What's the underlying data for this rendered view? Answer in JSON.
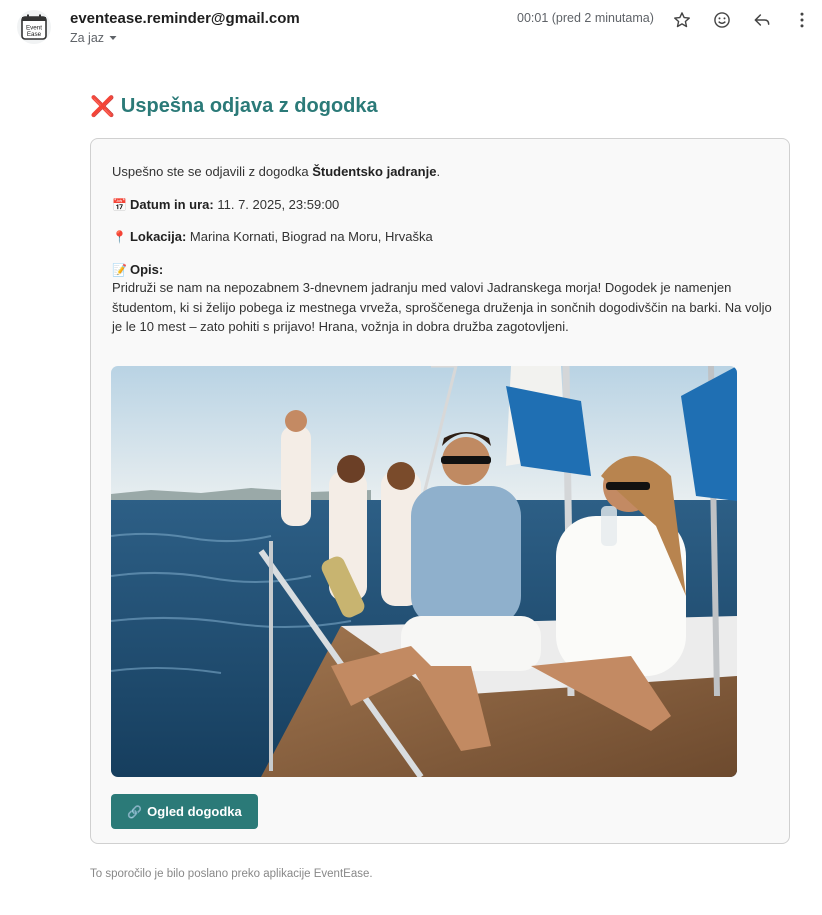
{
  "header": {
    "sender": "eventease.reminder@gmail.com",
    "to_label": "Za jaz",
    "time": "00:01 (pred 2 minutama)",
    "avatar_text_line1": "Event",
    "avatar_text_line2": "Ease",
    "icons": [
      "star-icon",
      "emoji-icon",
      "reply-icon",
      "more-icon"
    ]
  },
  "email": {
    "heading_icon": "❌",
    "heading": "Uspešna odjava z dogodka",
    "intro_prefix": "Uspešno ste se odjavili z dogodka ",
    "event_name": "Študentsko jadranje",
    "intro_suffix": ".",
    "date_icon": "📅",
    "date_label": "Datum in ura:",
    "date_value": " 11. 7. 2025, 23:59:00",
    "location_icon": "📍",
    "location_label": "Lokacija:",
    "location_value": " Marina Kornati, Biograd na Moru, Hrvaška",
    "desc_icon": "📝",
    "desc_label": "Opis:",
    "desc_text": "Pridruži se nam na nepozabnem 3-dnevnem jadranju med valovi Jadranskega morja! Dogodek je namenjen študentom, ki si želijo pobega iz mestnega vrveža, sproščenega druženja in sončnih dogodivščin na barki. Na voljo je le 10 mest – zato pohiti s prijavo! Hrana, vožnja in dobra družba zagotovljeni.",
    "button_icon": "🔗",
    "button_label": "Ogled dogodka",
    "footer": "To sporočilo je bilo poslano preko aplikacije EventEase."
  },
  "colors": {
    "accent": "#2b7a78",
    "card_bg": "#f9f9f9",
    "card_border": "#d0d0d0"
  }
}
